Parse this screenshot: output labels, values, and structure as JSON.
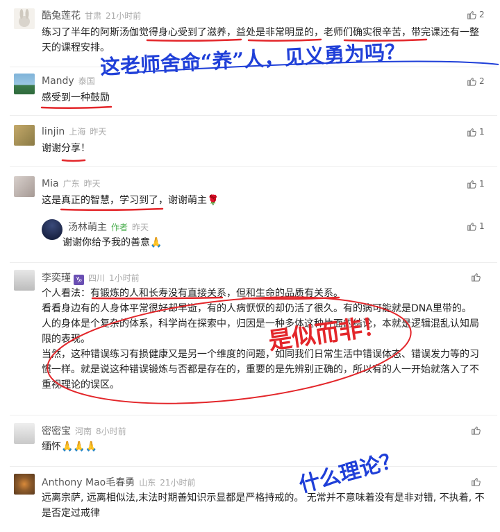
{
  "comments": [
    {
      "name": "酷兔莲花",
      "location": "甘肃",
      "time": "21小时前",
      "likes": "2",
      "text": "练习了半年的阿斯汤伽觉得身心受到了滋养，益处是非常明显的，老师们确实很辛苦，带完课还有一整天的课程安排。"
    },
    {
      "name": "Mandy",
      "location": "泰国",
      "likes": "2",
      "text": "感受到一种鼓励"
    },
    {
      "name": "linjin",
      "location": "上海",
      "time": "昨天",
      "likes": "1",
      "text": "谢谢分享！"
    },
    {
      "name": "Mia",
      "location": "广东",
      "time": "昨天",
      "likes": "1",
      "text": "这是真正的智慧，学习到了，谢谢萌主🌹",
      "reply": {
        "name": "汤林萌主",
        "role": "作者",
        "time": "昨天",
        "likes": "1",
        "text": "谢谢你给予我的善意🙏"
      }
    },
    {
      "name": "李奕瑾",
      "zodiac": "♑",
      "location": "四川",
      "time": "1小时前",
      "paragraphs": [
        "个人看法：有锻炼的人和长寿没有直接关系，但和生命的品质有关系。",
        "看看身边有的人身体平常很好却早逝，有的人病恹恹的却仍活了很久。有的病可能就是DNA里带的。",
        "人的身体是个复杂的体系，科学尚在探索中，归因是一种多体这种片面的结论，本就是逻辑混乱认知局限的表现。",
        "当然，这种错误练习有损健康又是另一个维度的问题，如同我们日常生活中错误体态、错误发力等的习惯一样。就是说这种错误锻炼与否都是存在的，重要的是先辨别正确的，所以有的人一开始就落入了不重视理论的误区。"
      ]
    },
    {
      "name": "密密宝",
      "location": "河南",
      "time": "8小时前",
      "text": "缅怀🙏🙏🙏"
    },
    {
      "name": "Anthony Mao毛春勇",
      "location": "山东",
      "time": "21小时前",
      "text": "远离宗萨, 远离相似法,末法时期善知识示显都是严格持戒的。 无常并不意味着没有是非对错, 不执着, 不是否定过戒律"
    }
  ],
  "annotations": {
    "note1": "这老师舍命“养”人，见义勇为吗？",
    "note2": "是似而非！",
    "note3": "什么理论？"
  },
  "colors": {
    "annotation_blue": "#1f3fd8",
    "annotation_red": "#e3262a",
    "name_gray": "#555555",
    "author_green": "#4caf50"
  }
}
